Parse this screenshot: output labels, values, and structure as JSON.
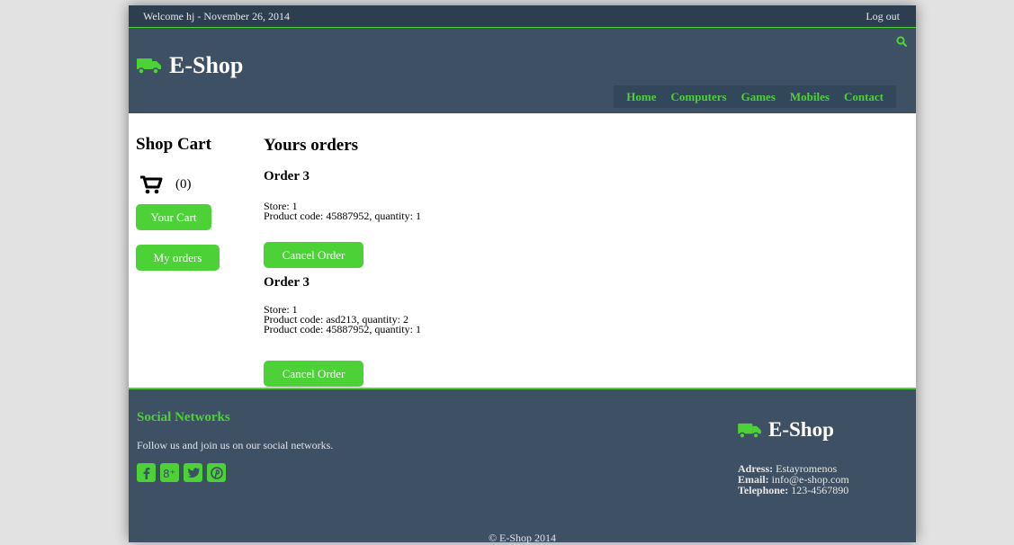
{
  "topbar": {
    "welcome": "Welcome hj -  November 26, 2014",
    "logout": "Log out"
  },
  "header": {
    "brand": "E-Shop",
    "nav": [
      "Home",
      "Computers",
      "Games",
      "Mobiles",
      "Contact"
    ]
  },
  "sidebar": {
    "title": "Shop Cart",
    "cart_count": "(0)",
    "your_cart": "Your Cart",
    "my_orders": "My orders"
  },
  "main": {
    "title": "Yours orders",
    "orders": [
      {
        "heading": "Order 3",
        "lines": [
          "Store: 1",
          "Product code: 45887952, quantity: 1"
        ],
        "cancel": "Cancel Order"
      },
      {
        "heading": "Order 3",
        "lines": [
          "Store: 1",
          "Product code: asd213, quantity: 2",
          "Product code: 45887952, quantity: 1"
        ],
        "cancel": "Cancel Order"
      }
    ]
  },
  "footer": {
    "social_title": "Social Networks",
    "social_text": "Follow us and join us on our social networks.",
    "social_icons": [
      "facebook-icon",
      "google-plus-icon",
      "twitter-icon",
      "pinterest-icon"
    ],
    "brand": "E-Shop",
    "address_label": "Adress:",
    "address": "Estayromenos",
    "email_label": "Email:",
    "email": "info@e-shop.com",
    "phone_label": "Telephone:",
    "phone": "123-4567890",
    "copyright": "© E-Shop 2014"
  },
  "colors": {
    "accent": "#4cd137",
    "header_bg": "#3e5063",
    "topbar_bg": "#2c3e50"
  }
}
